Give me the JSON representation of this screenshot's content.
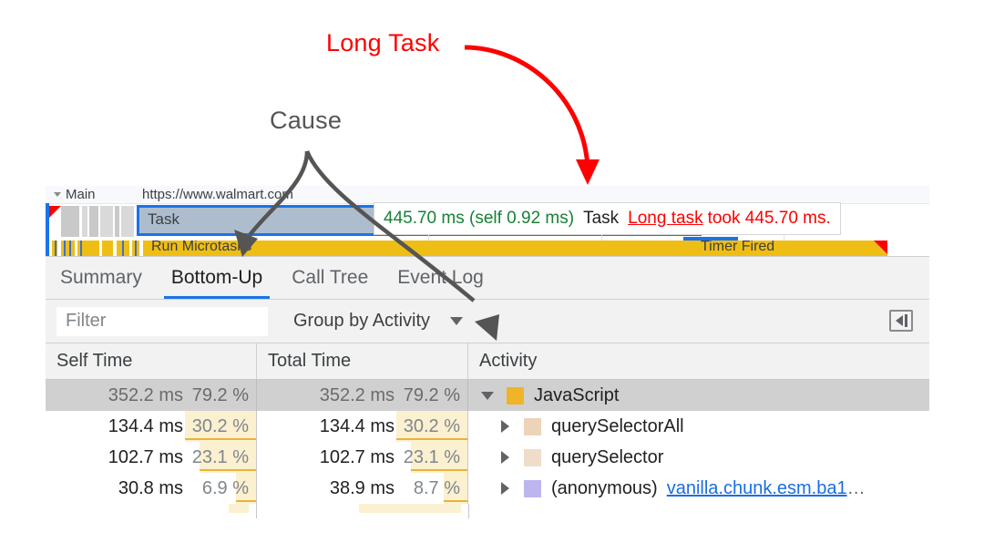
{
  "annotations": {
    "long_task": {
      "text": "Long Task",
      "color": "#ff0000"
    },
    "cause": {
      "text": "Cause",
      "color": "#555555"
    }
  },
  "flame_chart": {
    "track_expand_icon": "triangle-down-icon",
    "track_label": "Main",
    "track_url": "https://www.walmart.com",
    "selected_task_label": "Task",
    "microtasks_label": "Run Microtasks",
    "timer_label": "Timer Fired",
    "long_task_marker": "red-triangle-icon",
    "colors": {
      "selection_border": "#1a73e8",
      "selection_fill": "#aebdcd",
      "scripting": "#efbe15",
      "long_task_marker": "#ff0000"
    }
  },
  "tooltip": {
    "duration": "445.70 ms (self 0.92 ms)",
    "event_name": "Task",
    "warning_link": "Long task",
    "warning_text": "took 445.70 ms.",
    "colors": {
      "duration": "#188038",
      "warning": "#ff0000"
    }
  },
  "tabs": [
    {
      "label": "Summary",
      "active": false
    },
    {
      "label": "Bottom-Up",
      "active": true
    },
    {
      "label": "Call Tree",
      "active": false
    },
    {
      "label": "Event Log",
      "active": false
    }
  ],
  "toolbar": {
    "filter_placeholder": "Filter",
    "filter_value": "",
    "grouping_label": "Group by Activity",
    "grouping_chevron": "chevron-down-icon",
    "collapse_sidebar_icon": "collapse-sidebar-icon"
  },
  "table": {
    "headers": [
      "Self Time",
      "Total Time",
      "Activity"
    ],
    "rows": [
      {
        "self_time": "352.2 ms",
        "self_pct": "79.2 %",
        "self_pct_width": 0,
        "total_time": "352.2 ms",
        "total_pct": "79.2 %",
        "total_pct_width": 0,
        "disclosure": "triangle-down-icon",
        "swatch": "#f0b428",
        "activity": "JavaScript",
        "link": "",
        "ellipsis": "",
        "selected": true,
        "indent": 0
      },
      {
        "self_time": "134.4 ms",
        "self_pct": "30.2 %",
        "self_pct_width": 78,
        "total_time": "134.4 ms",
        "total_pct": "30.2 %",
        "total_pct_width": 78,
        "disclosure": "triangle-right-icon",
        "swatch": "#edd3b8",
        "activity": "querySelectorAll",
        "link": "",
        "ellipsis": "",
        "selected": false,
        "indent": 1
      },
      {
        "self_time": "102.7 ms",
        "self_pct": "23.1 %",
        "self_pct_width": 62,
        "total_time": "102.7 ms",
        "total_pct": "23.1 %",
        "total_pct_width": 62,
        "disclosure": "triangle-right-icon",
        "swatch": "#f0ddc9",
        "activity": "querySelector",
        "link": "",
        "ellipsis": "",
        "selected": false,
        "indent": 1
      },
      {
        "self_time": "30.8 ms",
        "self_pct": "6.9 %",
        "self_pct_width": 22,
        "total_time": "38.9 ms",
        "total_pct": "8.7 %",
        "total_pct_width": 26,
        "disclosure": "triangle-right-icon",
        "swatch": "#bcb6ef",
        "activity": "(anonymous)",
        "link": "vanilla.chunk.esm.ba1",
        "ellipsis": "…",
        "selected": false,
        "indent": 1
      }
    ],
    "partial_row": {
      "self_pct_width": 22,
      "total_pct_width": 112
    }
  }
}
